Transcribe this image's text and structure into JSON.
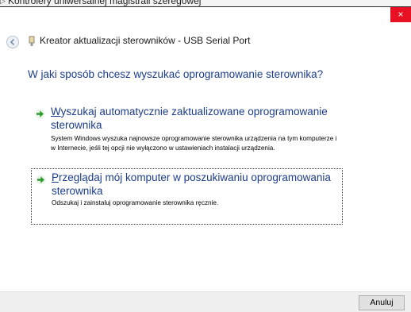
{
  "background_window": {
    "item_label": "Kontrolery uniwersalnej magistrali szeregowej"
  },
  "dialog": {
    "close_glyph": "×",
    "title": "Kreator aktualizacji sterowników - USB Serial Port",
    "question": "W jaki sposób chcesz wyszukać oprogramowanie sterownika?",
    "options": [
      {
        "title_accel": "W",
        "title_rest": "yszukaj automatycznie zaktualizowane oprogramowanie sterownika",
        "description": "System Windows wyszuka najnowsze oprogramowanie sterownika urządzenia na tym komputerze i w Internecie, jeśli tej opcji nie wyłączono w ustawieniach instalacji urządzenia.",
        "icon": "green-arrow-icon"
      },
      {
        "title_accel": "P",
        "title_rest": "rzeglądaj mój komputer w poszukiwaniu oprogramowania sterownika",
        "description": "Odszukaj i zainstaluj oprogramowanie sterownika ręcznie.",
        "icon": "green-arrow-icon"
      }
    ],
    "cancel_label": "Anuluj"
  },
  "colors": {
    "accent_text": "#1c3d8a",
    "close_red": "#e81123",
    "arrow_green": "#2e9a2e"
  }
}
